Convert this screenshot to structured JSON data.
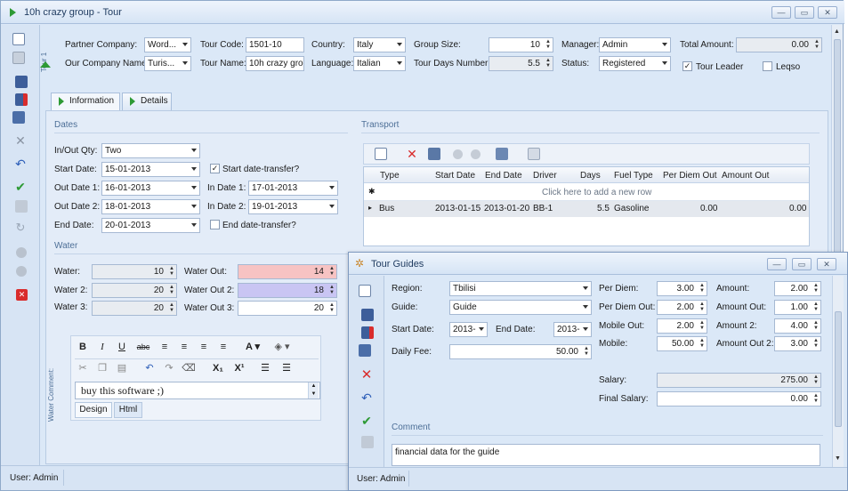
{
  "window": {
    "title": "10h crazy group - Tour"
  },
  "sidebar_tab": "Tour 1",
  "header": {
    "partner_company_label": "Partner Company:",
    "partner_company": "Word...",
    "our_company_label": "Our Company Name:",
    "our_company": "Turis...",
    "tour_code_label": "Tour Code:",
    "tour_code": "1501-10",
    "tour_name_label": "Tour Name:",
    "tour_name": "10h crazy grou",
    "country_label": "Country:",
    "country": "Italy",
    "language_label": "Language:",
    "language": "Italian",
    "group_size_label": "Group Size:",
    "group_size": "10",
    "tour_days_label": "Tour Days Number:",
    "tour_days": "5.5",
    "manager_label": "Manager:",
    "manager": "Admin",
    "status_label": "Status:",
    "status": "Registered",
    "total_amount_label": "Total Amount:",
    "total_amount": "0.00",
    "tour_leader_label": "Tour Leader",
    "tour_leader_checked": "✓",
    "leqso_label": "Leqso"
  },
  "tabs": {
    "information": "Information",
    "details": "Details"
  },
  "dates": {
    "section": "Dates",
    "inout_label": "In/Out Qty:",
    "inout": "Two",
    "start_date_label": "Start Date:",
    "start_date": "15-01-2013",
    "start_transfer_label": "Start date-transfer?",
    "start_transfer_checked": "✓",
    "out_date1_label": "Out Date 1:",
    "out_date1": "16-01-2013",
    "in_date1_label": "In Date 1:",
    "in_date1": "17-01-2013",
    "out_date2_label": "Out Date 2:",
    "out_date2": "18-01-2013",
    "in_date2_label": "In Date 2:",
    "in_date2": "19-01-2013",
    "end_date_label": "End Date:",
    "end_date": "20-01-2013",
    "end_transfer_label": "End date-transfer?"
  },
  "water": {
    "section": "Water",
    "water_label": "Water:",
    "water": "10",
    "water2_label": "Water 2:",
    "water2": "20",
    "water3_label": "Water 3:",
    "water3": "20",
    "water_out_label": "Water Out:",
    "water_out": "14",
    "water_out2_label": "Water Out 2:",
    "water_out2": "18",
    "water_out3_label": "Water Out 3:",
    "water_out3": "20",
    "comment_side_label": "Water Comment:",
    "comment_text": "buy this software ;)",
    "design_tab": "Design",
    "html_tab": "Html"
  },
  "transport": {
    "section": "Transport",
    "columns": [
      "Type",
      "Start Date",
      "End Date",
      "Driver",
      "Days",
      "Fuel Type",
      "Per Diem Out",
      "Amount Out"
    ],
    "new_row_hint": "Click here to add a new row",
    "row": {
      "type": "Bus",
      "start": "2013-01-15",
      "end": "2013-01-20",
      "driver": "BB-1",
      "days": "5.5",
      "fuel": "Gasoline",
      "per_diem_out": "0.00",
      "amount_out": "0.00"
    }
  },
  "guides": {
    "title": "Tour Guides",
    "region_label": "Region:",
    "region": "Tbilisi",
    "guide_label": "Guide:",
    "guide": "Guide",
    "start_date_label": "Start Date:",
    "start_date": "2013-",
    "end_date_label": "End Date:",
    "end_date": "2013-",
    "daily_fee_label": "Daily Fee:",
    "daily_fee": "50.00",
    "per_diem_label": "Per Diem:",
    "per_diem": "3.00",
    "per_diem_out_label": "Per Diem Out:",
    "per_diem_out": "2.00",
    "mobile_out_label": "Mobile Out:",
    "mobile_out": "2.00",
    "mobile_label": "Mobile:",
    "mobile": "50.00",
    "amount_label": "Amount:",
    "amount": "2.00",
    "amount_out_label": "Amount Out:",
    "amount_out": "1.00",
    "amount2_label": "Amount 2:",
    "amount2": "4.00",
    "amount_out2_label": "Amount Out 2:",
    "amount_out2": "3.00",
    "salary_label": "Salary:",
    "salary": "275.00",
    "final_salary_label": "Final Salary:",
    "final_salary": "0.00",
    "comment_section": "Comment",
    "comment": "financial data for the guide"
  },
  "statusbar": {
    "main": "User: Admin",
    "guides": "User: Admin"
  },
  "colors": {
    "water_out": "#f7c3c3",
    "water_out2": "#c9c5f3",
    "accent": "#2e9a35",
    "delete": "#d92c2c"
  }
}
